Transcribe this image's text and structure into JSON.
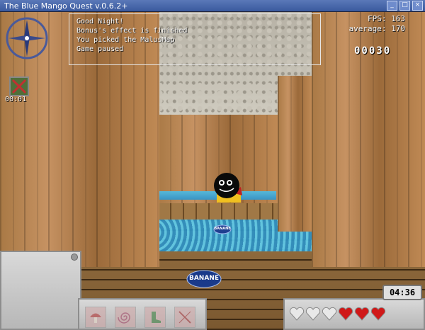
{
  "window": {
    "title": "The Blue Mango Quest v.0.6.2+"
  },
  "hud": {
    "messages": [
      "Good Night!",
      "Bonus's effect is finished",
      "You picked the MalusMap",
      "Game paused"
    ],
    "fps_label": "FPS:",
    "fps_value": "163",
    "average_label": "average:",
    "average_value": "170",
    "score": "00030",
    "map_timer": "00:01",
    "level_timer": "04:36",
    "lives_total": 6,
    "lives_remaining": 3
  },
  "items": {
    "banana_label": "BANANE"
  },
  "colors": {
    "heart_full": "#d01818",
    "heart_empty": "#e8e8e8",
    "hud_text": "#f2f2f2"
  },
  "icons": [
    "compass-icon",
    "map-malus-icon",
    "mushroom-icon",
    "spiral-icon",
    "boot-icon",
    "crossed-icon",
    "heart-icon"
  ]
}
